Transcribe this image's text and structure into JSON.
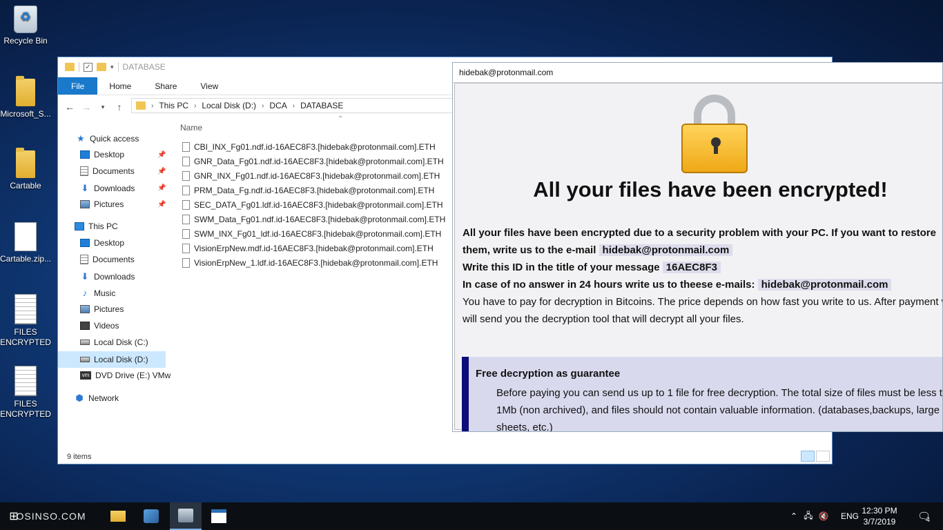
{
  "desktop": {
    "icons": [
      {
        "label": "Recycle Bin"
      },
      {
        "label": "Microsoft_S..."
      },
      {
        "label": "Cartable"
      },
      {
        "label": "Cartable.zip..."
      },
      {
        "label": "FILES ENCRYPTED"
      },
      {
        "label": "FILES ENCRYPTED"
      }
    ]
  },
  "explorer": {
    "title": "DATABASE",
    "ribbon": {
      "file": "File",
      "home": "Home",
      "share": "Share",
      "view": "View"
    },
    "breadcrumb": [
      "This PC",
      "Local Disk (D:)",
      "DCA",
      "DATABASE"
    ],
    "sidebar": {
      "quick_access": "Quick access",
      "qa_desktop": "Desktop",
      "qa_documents": "Documents",
      "qa_downloads": "Downloads",
      "qa_pictures": "Pictures",
      "this_pc": "This PC",
      "pc_desktop": "Desktop",
      "pc_documents": "Documents",
      "pc_downloads": "Downloads",
      "pc_music": "Music",
      "pc_pictures": "Pictures",
      "pc_videos": "Videos",
      "disk_c": "Local Disk (C:)",
      "disk_d": "Local Disk (D:)",
      "dvd": "DVD Drive (E:) VMw",
      "network": "Network"
    },
    "column_name": "Name",
    "files": [
      "CBI_INX_Fg01.ndf.id-16AEC8F3.[hidebak@protonmail.com].ETH",
      "GNR_Data_Fg01.ndf.id-16AEC8F3.[hidebak@protonmail.com].ETH",
      "GNR_INX_Fg01.ndf.id-16AEC8F3.[hidebak@protonmail.com].ETH",
      "PRM_Data_Fg.ndf.id-16AEC8F3.[hidebak@protonmail.com].ETH",
      "SEC_DATA_Fg01.ldf.id-16AEC8F3.[hidebak@protonmail.com].ETH",
      "SWM_Data_Fg01.ndf.id-16AEC8F3.[hidebak@protonmail.com].ETH",
      "SWM_INX_Fg01_ldf.id-16AEC8F3.[hidebak@protonmail.com].ETH",
      "VisionErpNew.mdf.id-16AEC8F3.[hidebak@protonmail.com].ETH",
      "VisionErpNew_1.ldf.id-16AEC8F3.[hidebak@protonmail.com].ETH"
    ],
    "status": "9 items"
  },
  "ransom": {
    "title": "hidebak@protonmail.com",
    "headline": "All your files have been encrypted!",
    "line1": "All your files have been encrypted due to a security problem with your PC. If you want to restore",
    "line2_prefix": "them, write us to the e-mail",
    "email1": "hidebak@protonmail.com",
    "line3_prefix": "Write this ID in the title of your message",
    "id": "16AEC8F3",
    "line4_prefix": "In case of no answer in 24 hours write us to theese e-mails:",
    "email2": "hidebak@protonmail.com",
    "line5": "You have to pay for decryption in Bitcoins. The price depends on how fast you write to us. After payment we",
    "line6": "will send you the decryption tool that will decrypt all your files.",
    "guarantee_title": "Free decryption as guarantee",
    "guarantee_l1": "Before paying you can send us up to 1 file for free decryption. The total size of files must be less than",
    "guarantee_l2": "1Mb (non archived), and files should not contain valuable information. (databases,backups, large excel",
    "guarantee_l3": "sheets, etc.)"
  },
  "taskbar": {
    "watermark": "OSINSO.COM",
    "language": "ENG",
    "time": "12:30 PM",
    "date": "3/7/2019",
    "notifications": "4"
  }
}
